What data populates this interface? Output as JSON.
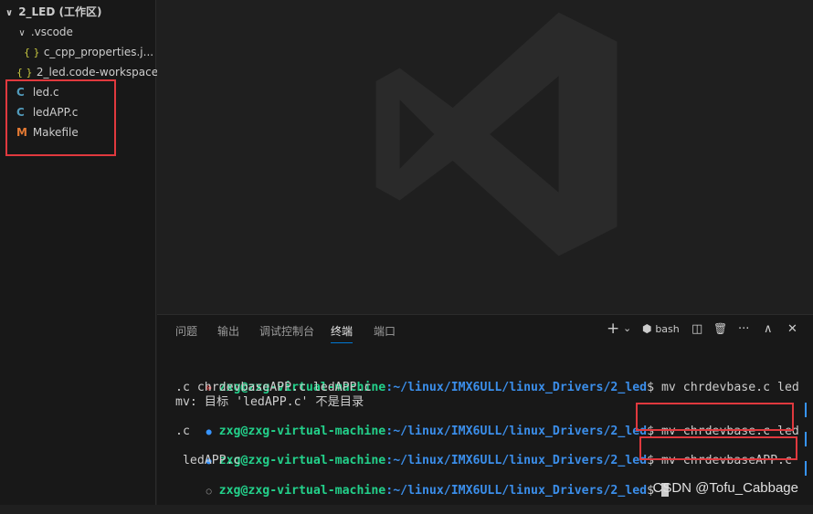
{
  "explorer": {
    "workspace_title": "2_LED (工作区)",
    "items": [
      {
        "label": ".vscode",
        "icon": "chevron-down"
      },
      {
        "label": "c_cpp_properties.j...",
        "icon": "json-braces"
      },
      {
        "label": "2_led.code-workspace",
        "icon": "json-braces"
      },
      {
        "label": "led.c",
        "icon": "c-file"
      },
      {
        "label": "ledAPP.c",
        "icon": "c-file"
      },
      {
        "label": "Makefile",
        "icon": "makefile"
      }
    ],
    "icon_glyphs": {
      "chevron": "∨",
      "json": "{ }",
      "c": "C",
      "makefile": "M"
    }
  },
  "panel": {
    "tabs": [
      "问题",
      "输出",
      "调试控制台",
      "终端",
      "端口"
    ],
    "active_tab": "终端",
    "toolbar": {
      "add": "+",
      "add_dropdown": "⌄",
      "shell_label": "bash",
      "split": "◫",
      "trash": "🗑",
      "more": "···",
      "maximize": "∧",
      "close": "✕"
    }
  },
  "terminal": {
    "prompt_user": "zxg@zxg-virtual-machine",
    "prompt_path": ":~/linux/IMX6ULL/linux_Drivers/2_led",
    "lines": [
      {
        "status": "error",
        "marker": "⊗",
        "command": "$ mv chrdevbase.c led",
        "wrap": ".c chrdevbaseAPP.c ledAPP.c"
      },
      {
        "output": "mv: 目标 'ledAPP.c' 不是目录"
      },
      {
        "status": "success",
        "marker": "●",
        "command": "$ mv chrdevbase.c led",
        "wrap": ".c"
      },
      {
        "status": "success",
        "marker": "●",
        "command": "$ mv chrdevbaseAPP.c",
        "wrap": " ledAPP.c"
      },
      {
        "status": "idle",
        "marker": "○",
        "command": "$ "
      }
    ]
  },
  "watermark": "CSDN @Tofu_Cabbage",
  "colors": {
    "accent": "#0078d4",
    "highlight_box": "#e0393e",
    "prompt_green": "#23d18b",
    "prompt_blue": "#3b8eea",
    "error": "#f14c4c",
    "success": "#3794ff"
  }
}
